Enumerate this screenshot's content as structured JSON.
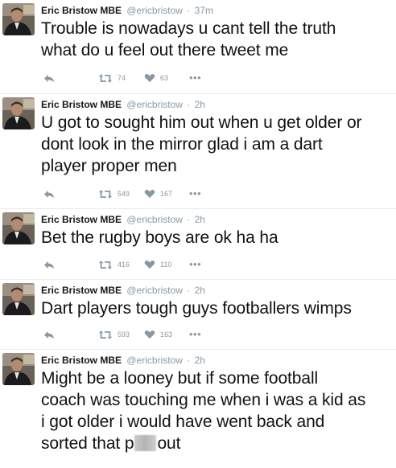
{
  "tweets": [
    {
      "name": "Eric Bristow MBE",
      "handle": "@ericbristow",
      "separator": "·",
      "time": "37m",
      "lines": [
        "Trouble is nowadays u cant tell the truth",
        "what do u feel out there tweet me"
      ],
      "retweets": "74",
      "likes": "63"
    },
    {
      "name": "Eric Bristow MBE",
      "handle": "@ericbristow",
      "separator": "·",
      "time": "2h",
      "lines": [
        "U got to sought him out when u get older or",
        "dont look in the mirror glad i am a dart",
        "player proper men"
      ],
      "retweets": "549",
      "likes": "167"
    },
    {
      "name": "Eric Bristow MBE",
      "handle": "@ericbristow",
      "separator": "·",
      "time": "2h",
      "lines": [
        "Bet the rugby boys are ok ha ha"
      ],
      "retweets": "416",
      "likes": "110"
    },
    {
      "name": "Eric Bristow MBE",
      "handle": "@ericbristow",
      "separator": "·",
      "time": "2h",
      "lines": [
        "Dart players tough guys footballers wimps"
      ],
      "retweets": "593",
      "likes": "163"
    },
    {
      "name": "Eric Bristow MBE",
      "handle": "@ericbristow",
      "separator": "·",
      "time": "2h",
      "lines": [
        "Might be a looney but if some football",
        "coach was touching me when i was a kid as",
        "i got older i would have went back and"
      ],
      "last_line_start": "sorted that p",
      "last_line_end": "out"
    }
  ],
  "more_label": "•••",
  "icons": {
    "reply": "reply-arrow-icon",
    "retweet": "retweet-icon",
    "like": "heart-icon",
    "more": "more-dots-icon"
  },
  "colors": {
    "action_grey": "#8899a6",
    "divider": "#e6ecf0",
    "text": "#14171a"
  }
}
